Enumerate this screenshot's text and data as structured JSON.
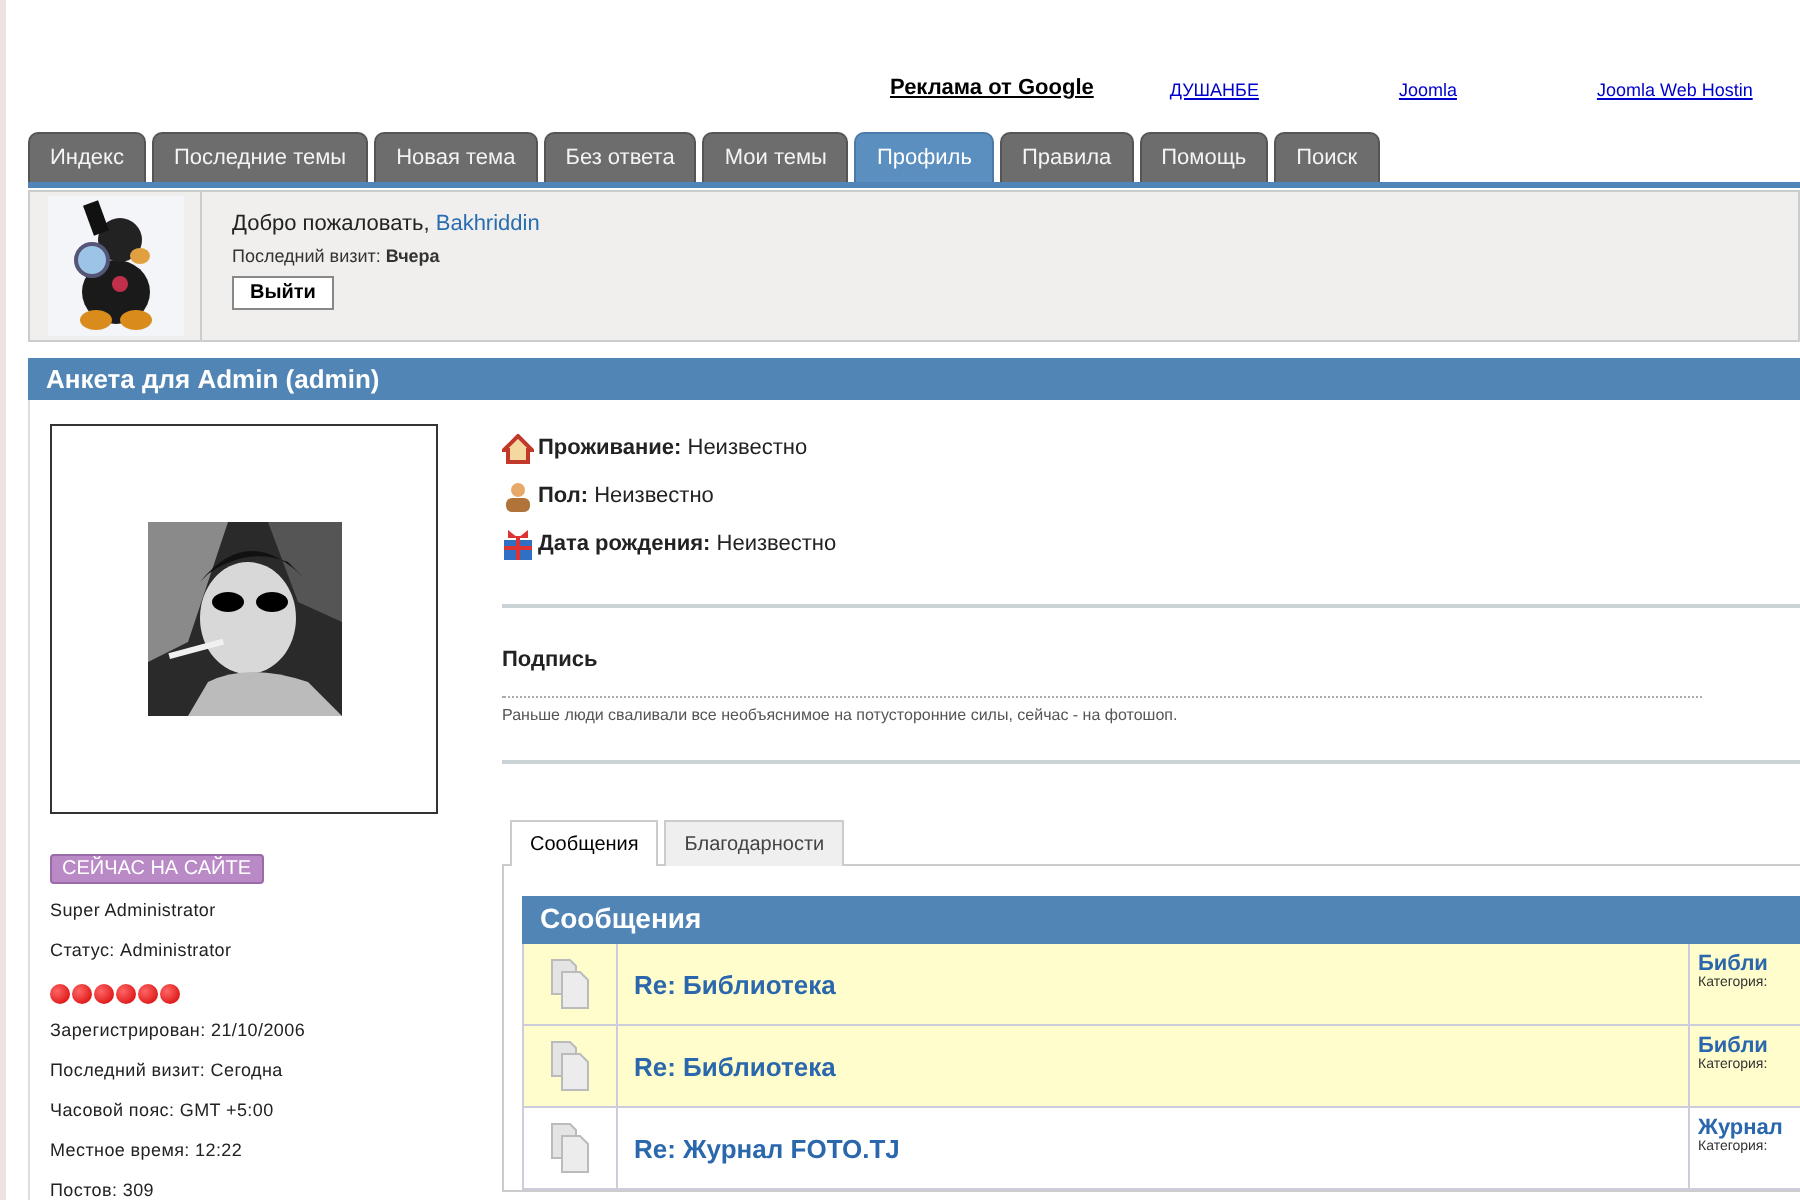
{
  "ads": {
    "title": "Реклама от Google",
    "links": [
      "ДУШАНБЕ",
      "Joomla",
      "Joomla Web Hostin"
    ]
  },
  "tabs": [
    {
      "label": "Индекс",
      "selected": false
    },
    {
      "label": "Последние темы",
      "selected": false
    },
    {
      "label": "Новая тема",
      "selected": false
    },
    {
      "label": "Без ответа",
      "selected": false
    },
    {
      "label": "Мои темы",
      "selected": false
    },
    {
      "label": "Профиль",
      "selected": true
    },
    {
      "label": "Правила",
      "selected": false
    },
    {
      "label": "Помощь",
      "selected": false
    },
    {
      "label": "Поиск",
      "selected": false
    }
  ],
  "user_panel": {
    "greeting": "Добро пожаловать,",
    "username": "Bakhriddin",
    "last_visit_label": "Последний визит:",
    "last_visit": "Вчера",
    "logout": "Выйти"
  },
  "profile": {
    "title": "Анкета для Admin (admin)",
    "online_badge": "СЕЙЧАС НА САЙТЕ",
    "role": "Super Administrator",
    "status": "Статус: Administrator",
    "rank": {
      "stars": 6
    },
    "stats": [
      "Зарегистрирован: 21/10/2006",
      "Последний визит: Сегодна",
      "Часовой пояс: GMT +5:00",
      "Местное время: 12:22",
      "Постов: 309"
    ],
    "fields": [
      {
        "kind": "home",
        "label": "Проживание:",
        "value": "Неизвестно"
      },
      {
        "kind": "gender",
        "label": "Пол:",
        "value": "Неизвестно"
      },
      {
        "kind": "birthday",
        "label": "Дата рождения:",
        "value": "Неизвестно"
      }
    ],
    "signature_title": "Подпись",
    "signature": "Раньше люди сваливали все необъяснимое на потусторонние силы, сейчас - на фотошоп."
  },
  "message_tabs": [
    {
      "label": "Сообщения",
      "selected": true
    },
    {
      "label": "Благодарности",
      "selected": false
    }
  ],
  "messages": {
    "title": "Сообщения",
    "rows": [
      {
        "subject": "Re: Библиотека",
        "topic": "Библи",
        "category": "Категория:",
        "highlighted": true
      },
      {
        "subject": "Re: Библиотека",
        "topic": "Библи",
        "category": "Категория:",
        "highlighted": true
      },
      {
        "subject": "Re: Журнал FOTO.TJ",
        "topic": "Журнал",
        "category": "Категория:",
        "highlighted": false
      }
    ]
  }
}
